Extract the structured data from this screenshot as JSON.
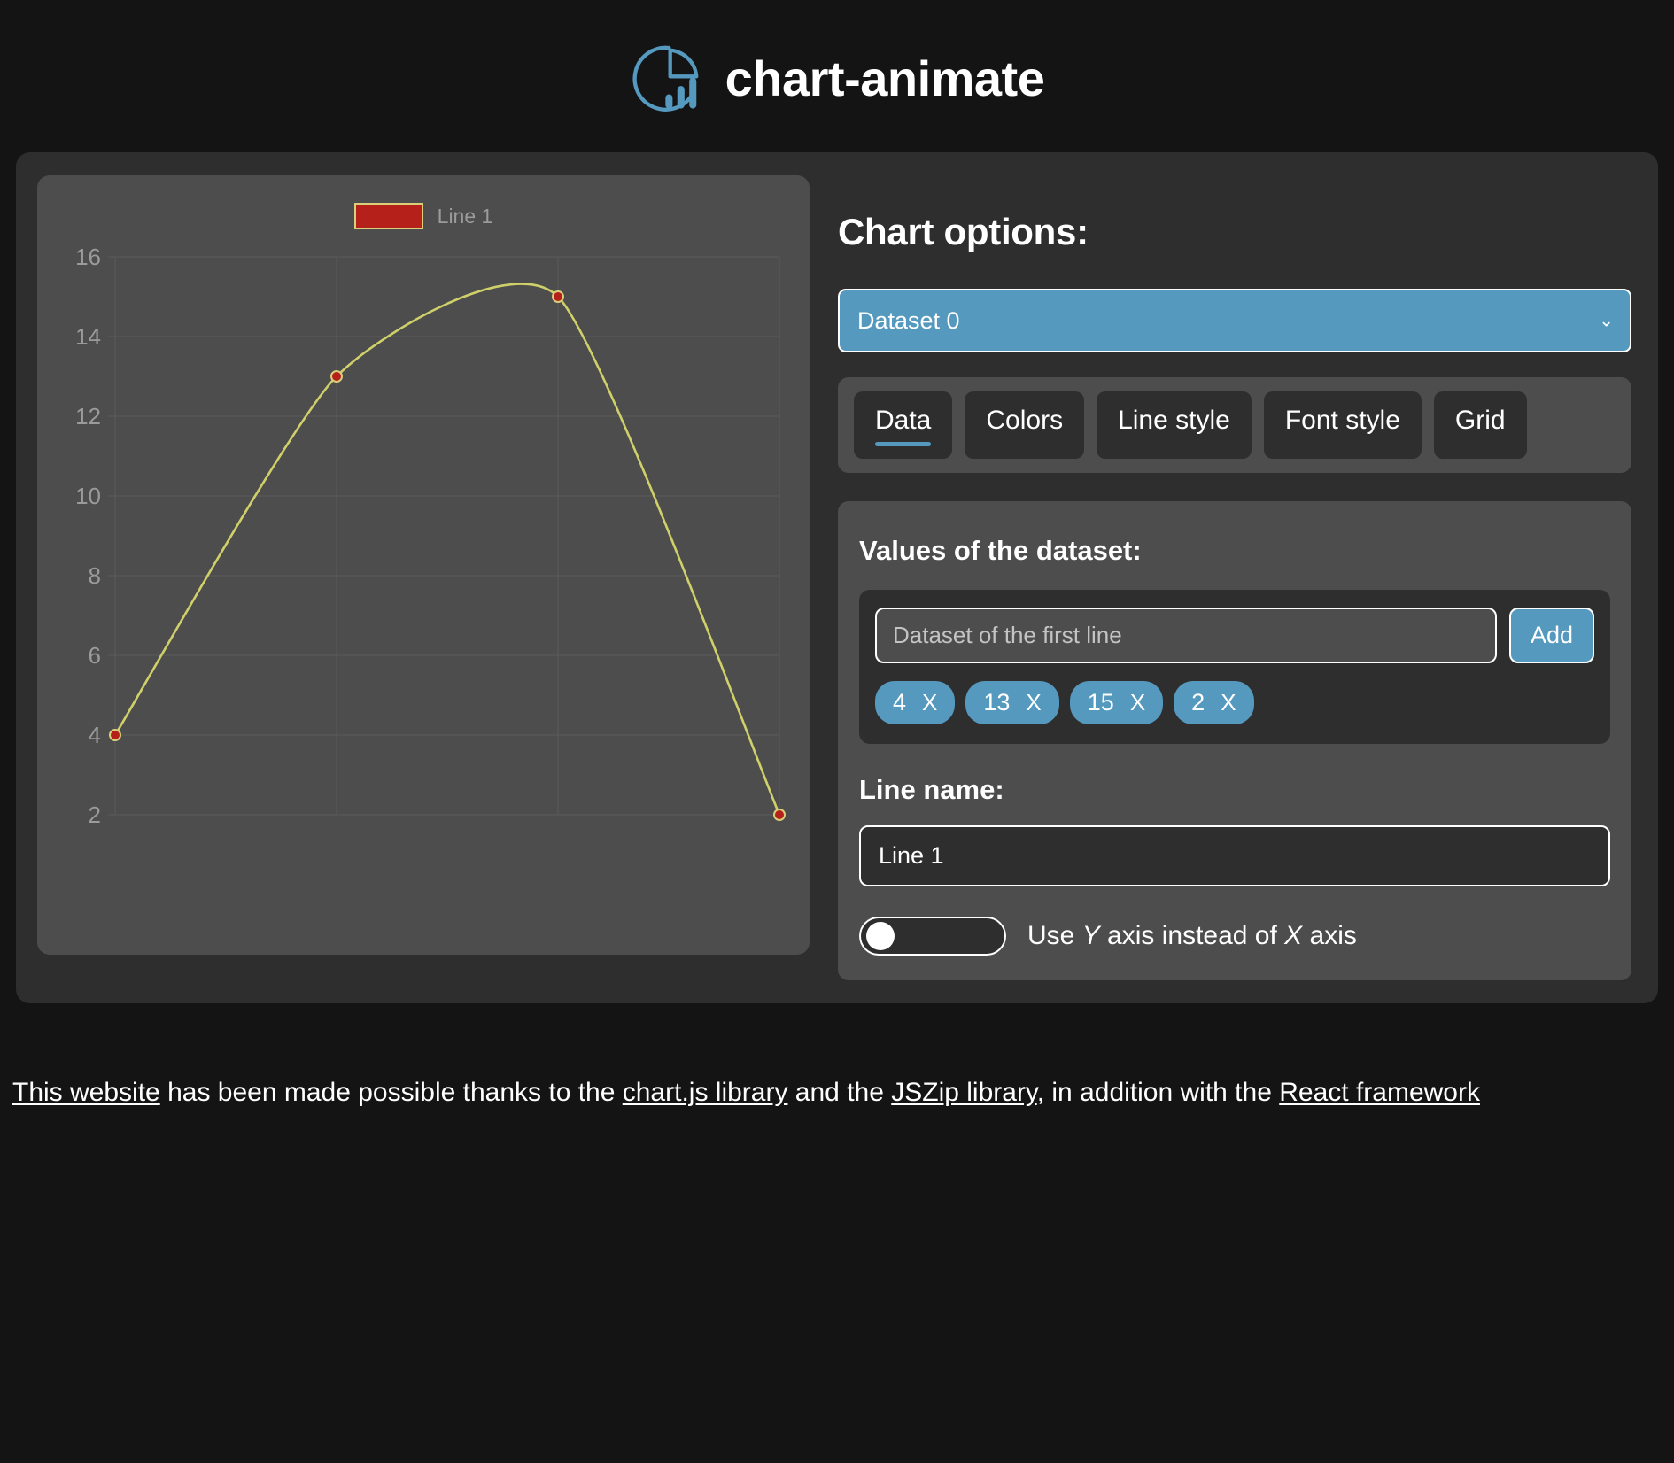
{
  "header": {
    "title": "chart-animate",
    "logo_icon": "pie-bar-chart-icon",
    "logo_color": "#5599bf"
  },
  "chart_data": {
    "type": "line",
    "title": "",
    "xlabel": "",
    "ylabel": "",
    "legend": [
      {
        "name": "Line 1",
        "fill": "#b5201a",
        "border": "#d9cf7a"
      }
    ],
    "series": [
      {
        "name": "Line 1",
        "values": [
          4,
          13,
          15,
          2
        ],
        "line_color": "#cfd06a",
        "point_fill": "#b5201a",
        "point_border": "#d9cf7a"
      }
    ],
    "x": [
      0,
      1,
      2,
      3
    ],
    "categories": [
      "",
      "",
      "",
      ""
    ],
    "ytick_labels": [
      "16",
      "14",
      "12",
      "10",
      "8",
      "6",
      "4",
      "2"
    ],
    "yticks": [
      16,
      14,
      12,
      10,
      8,
      6,
      4,
      2
    ],
    "ylim": [
      2,
      16
    ],
    "xlim": [
      0,
      3
    ],
    "grid": true,
    "legend_position": "top",
    "tension": "monotone"
  },
  "options": {
    "title": "Chart options:",
    "dataset_select": {
      "value": "Dataset 0",
      "options": [
        "Dataset 0"
      ],
      "chevron": "chevron-down-icon",
      "accent": "#5599bf"
    },
    "tabs": [
      {
        "label": "Data",
        "active": true
      },
      {
        "label": "Colors",
        "active": false
      },
      {
        "label": "Line style",
        "active": false
      },
      {
        "label": "Font style",
        "active": false
      },
      {
        "label": "Grid",
        "active": false
      }
    ],
    "values_section": {
      "heading": "Values of the dataset:",
      "input_value": "",
      "input_placeholder": "Dataset of the first line",
      "add_label": "Add",
      "chips": [
        {
          "value": "4",
          "remove": "X"
        },
        {
          "value": "13",
          "remove": "X"
        },
        {
          "value": "15",
          "remove": "X"
        },
        {
          "value": "2",
          "remove": "X"
        }
      ]
    },
    "line_name": {
      "heading": "Line name:",
      "value": "Line 1"
    },
    "axis_toggle": {
      "checked": false,
      "label_pre": "Use ",
      "label_y": "Y",
      "label_mid": " axis instead of ",
      "label_x": "X",
      "label_post": " axis"
    }
  },
  "footer": {
    "link_website": "This website",
    "text_1": " has been made possible thanks to the ",
    "link_chartjs": "chart.js library",
    "text_2": " and the ",
    "link_jszip": "JSZip library",
    "text_3": ", in addition with the ",
    "link_react": "React framework"
  }
}
